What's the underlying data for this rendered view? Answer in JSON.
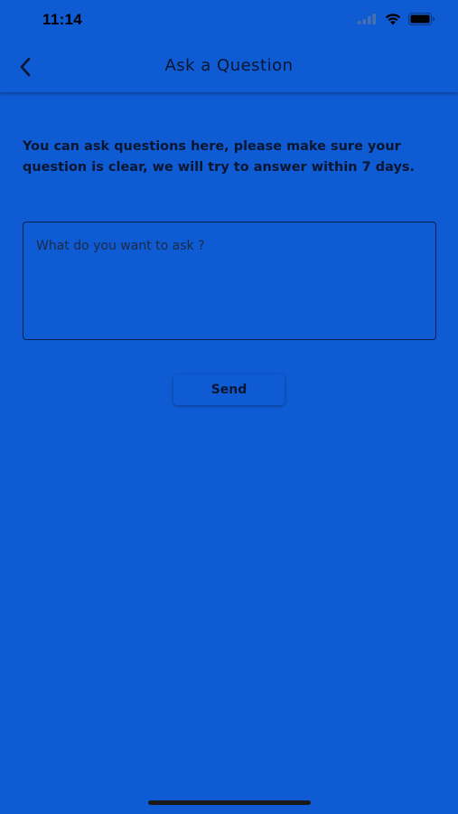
{
  "status_bar": {
    "time": "11:14",
    "icons": [
      "signal-icon",
      "wifi-icon",
      "battery-icon"
    ]
  },
  "nav": {
    "title": "Ask a Question",
    "back_icon": "chevron-left-icon"
  },
  "intro": {
    "text": "You can ask questions here, please make sure your question is clear, we will try to answer within 7 days."
  },
  "question": {
    "value": "",
    "placeholder": "What do you want to ask ?"
  },
  "send": {
    "label": "Send"
  },
  "colors": {
    "background": "#0e5bd3",
    "text": "#0a1630"
  }
}
